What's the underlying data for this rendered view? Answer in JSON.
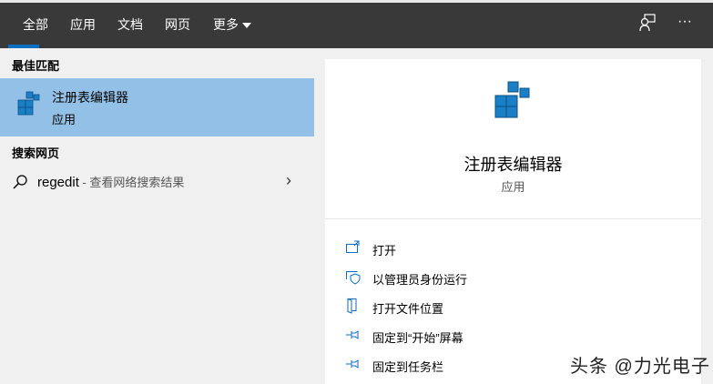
{
  "tabs": [
    {
      "label": "全部"
    },
    {
      "label": "应用"
    },
    {
      "label": "文档"
    },
    {
      "label": "网页"
    },
    {
      "label": "更多"
    }
  ],
  "toolbar": {
    "feedback_icon": "feedback-person-icon",
    "more_label": "···"
  },
  "best_match": {
    "heading": "最佳匹配",
    "name": "注册表编辑器",
    "type": "应用"
  },
  "web_search": {
    "heading": "搜索网页",
    "query": "regedit",
    "desc": " - 查看网络搜索结果"
  },
  "detail": {
    "name": "注册表编辑器",
    "type": "应用",
    "actions": [
      {
        "label": "打开"
      },
      {
        "label": "以管理员身份运行"
      },
      {
        "label": "打开文件位置"
      },
      {
        "label": "固定到“开始”屏幕"
      },
      {
        "label": "固定到任务栏"
      }
    ]
  },
  "watermark": "头条 @力光电子",
  "colors": {
    "accent": "#0a6fc2",
    "selected": "#92c0e6",
    "topbar": "#393939"
  }
}
